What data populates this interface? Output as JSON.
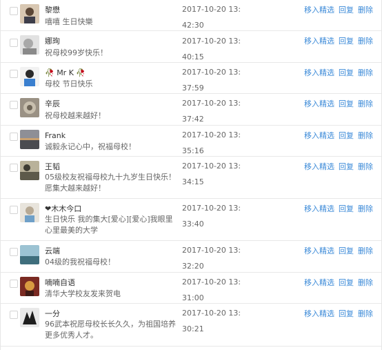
{
  "actions": {
    "feature_label": "移入精选",
    "reply_label": "回复",
    "delete_label": "删除"
  },
  "comments": [
    {
      "name": "黎懋",
      "message": "嘻嘻 生日快樂",
      "time": "2017-10-20 13:42:30",
      "avatar_color": "#c9b39a"
    },
    {
      "name": "娜珣",
      "message": "祝母校99岁快乐！",
      "time": "2017-10-20 13:40:15",
      "avatar_color": "#cfcfcf"
    },
    {
      "name": "🥀 Mr K 🥀",
      "message": "母校 节日快乐",
      "time": "2017-10-20 13:37:59",
      "avatar_color": "#3a7fcf"
    },
    {
      "name": "辛辰",
      "message": "祝母校越来越好！",
      "time": "2017-10-20 13:37:42",
      "avatar_color": "#8b8070"
    },
    {
      "name": "Frank",
      "message": "诚毅永记心中，祝福母校！",
      "time": "2017-10-20 13:35:16",
      "avatar_color": "#6d6f74"
    },
    {
      "name": "王韬",
      "message": "05级校友祝福母校九十九岁生日快乐！愿集大越来越好！",
      "time": "2017-10-20 13:34:15",
      "avatar_color": "#7c7763"
    },
    {
      "name": "❤木木今口",
      "message": "生日快乐 我的集大[爱心][爱心]我眼里心里最美的大学",
      "time": "2017-10-20 13:33:40",
      "avatar_color": "#d9d4cb"
    },
    {
      "name": "云端",
      "message": "04级的我祝福母校！",
      "time": "2017-10-20 13:32:20",
      "avatar_color": "#5a8fa0"
    },
    {
      "name": "喃喃自语",
      "message": "清华大学校友发来贺电",
      "time": "2017-10-20 13:31:00",
      "avatar_color": "#9b3a2e"
    },
    {
      "name": "一分",
      "message": "96武本祝愿母校长长久久，为祖国培养更多优秀人才。",
      "time": "2017-10-20 13:30:21",
      "avatar_color": "#2a2a2a"
    }
  ]
}
